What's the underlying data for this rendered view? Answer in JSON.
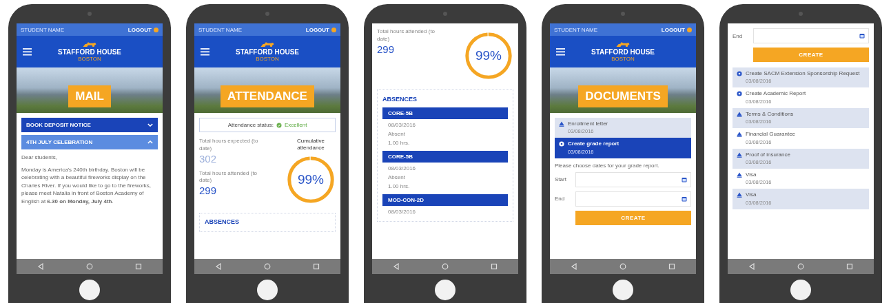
{
  "phones": [
    {
      "kind": "mail",
      "top_bar": {
        "student_name": "STUDENT NAME",
        "logout": "LOGOUT"
      },
      "brand": {
        "name": "STAFFORD HOUSE",
        "city": "BOSTON"
      },
      "hero_title": "MAIL",
      "accordions": [
        {
          "title": "BOOK DEPOSIT NOTICE",
          "expanded": false
        },
        {
          "title": "4TH JULY CELEBRATION",
          "expanded": true
        }
      ],
      "message": [
        "Dear students,",
        "Monday is America's 240th birthday. Boston will be celebrating with a beautiful fireworks display on the Charles River. If you would like to go to the fireworks, please meet Natalia in front of Boston Academy of English at **6.30 on Monday, July 4th**."
      ]
    },
    {
      "kind": "attendance",
      "top_bar": {
        "student_name": "STUDENT NAME",
        "logout": "LOGOUT"
      },
      "brand": {
        "name": "STAFFORD HOUSE",
        "city": "BOSTON"
      },
      "hero_title": "ATTENDANCE",
      "status": {
        "label": "Attendance status:",
        "value": "Excellent"
      },
      "stats": [
        {
          "label": "Total hours expected (to date)",
          "value": "302"
        },
        {
          "label": "Total hours attended (to date)",
          "value": "299"
        }
      ],
      "cumulative": {
        "label": "Cumulative attendance",
        "reading": "99%",
        "level": 0.99
      },
      "absences_title": "ABSENCES"
    },
    {
      "kind": "absences",
      "stats": [
        {
          "label": "Total hours attended (to date)",
          "value": "299"
        }
      ],
      "cumulative": {
        "reading": "99%",
        "level": 0.99
      },
      "absences_title": "ABSENCES",
      "absences": [
        {
          "course": "CORE-5B",
          "lines": [
            "08/03/2016",
            "Absent",
            "1.00 hrs."
          ]
        },
        {
          "course": "CORE-5B",
          "lines": [
            "08/03/2016",
            "Absent",
            "1.00 hrs."
          ]
        },
        {
          "course": "MOD-CON-2D",
          "lines": [
            "08/03/2016"
          ]
        }
      ]
    },
    {
      "kind": "documents",
      "top_bar": {
        "student_name": "STUDENT NAME",
        "logout": "LOGOUT"
      },
      "brand": {
        "name": "STAFFORD HOUSE",
        "city": "BOSTON"
      },
      "hero_title": "DOCUMENTS",
      "documents": [
        {
          "kind": "download",
          "title": "Enrollment letter",
          "date": "03/08/2016",
          "selected": false
        },
        {
          "kind": "create",
          "title": "Create grade report",
          "date": "03/08/2016",
          "selected": true
        }
      ],
      "prompt": "Please choose dates for your grade report.",
      "fields": [
        {
          "label": "Start"
        },
        {
          "label": "End"
        }
      ],
      "button": "CREATE"
    },
    {
      "kind": "document_list",
      "fields": [
        {
          "label": "End"
        }
      ],
      "button": "CREATE",
      "documents": [
        {
          "kind": "create",
          "title": "Create SACM Extension Sponsorship Request",
          "date": "03/08/2016",
          "selected": false
        },
        {
          "kind": "create",
          "title": "Create Academic Report",
          "date": "03/08/2016",
          "selected": false
        },
        {
          "kind": "download",
          "title": "Terms & Conditions",
          "date": "03/08/2016",
          "selected": false
        },
        {
          "kind": "download",
          "title": "Financial Guarantee",
          "date": "03/08/2016",
          "selected": false
        },
        {
          "kind": "download",
          "title": "Proof of insurance",
          "date": "03/08/2016",
          "selected": false
        },
        {
          "kind": "download",
          "title": "Visa",
          "date": "03/08/2016",
          "selected": false
        },
        {
          "kind": "download",
          "title": "Visa",
          "date": "03/08/2016",
          "selected": false
        }
      ]
    }
  ]
}
